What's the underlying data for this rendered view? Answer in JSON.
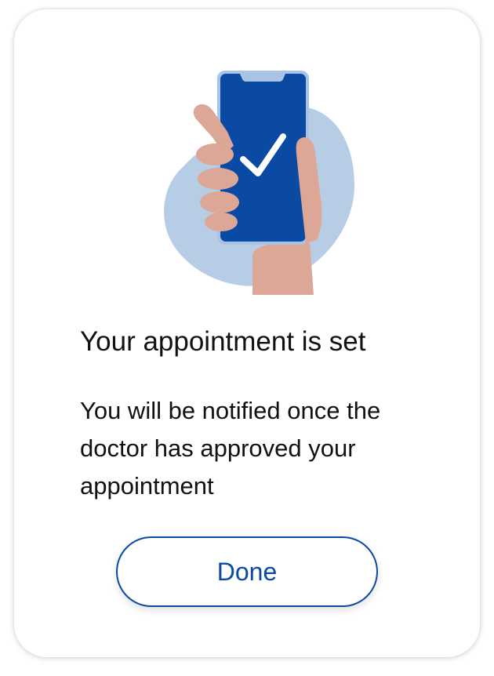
{
  "dialog": {
    "title": "Your appointment is set",
    "message": "You will be notified once the doctor has approved your appointment",
    "done_label": "Done"
  },
  "illustration": {
    "icon": "hand-holding-phone-checkmark-icon",
    "colors": {
      "blob": "#b7cde6",
      "phone_frame": "#a9c3e6",
      "phone_screen": "#0a4aa3",
      "hand": "#dca796",
      "hand_shadow": "#c48b79",
      "check": "#ffffff"
    }
  },
  "theme": {
    "accent": "#0a4aa3",
    "text": "#111111",
    "background": "#ffffff"
  }
}
